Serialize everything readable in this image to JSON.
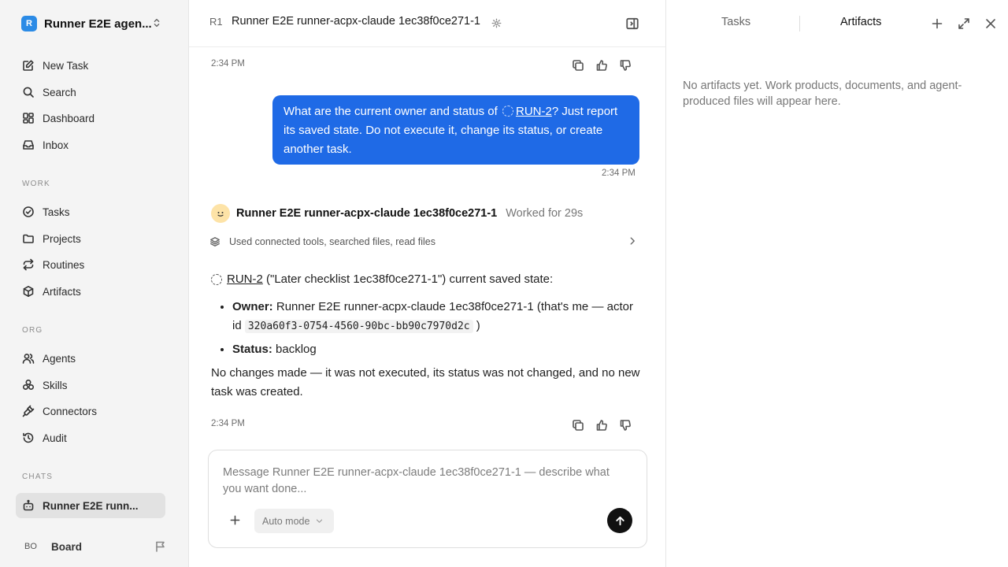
{
  "sidebar": {
    "workspace": {
      "logo": "R",
      "name": "Runner E2E agen..."
    },
    "primary": [
      {
        "label": "New Task",
        "icon": "edit-icon"
      },
      {
        "label": "Search",
        "icon": "search-icon"
      },
      {
        "label": "Dashboard",
        "icon": "dashboard-icon"
      },
      {
        "label": "Inbox",
        "icon": "inbox-icon"
      }
    ],
    "work_label": "WORK",
    "work": [
      {
        "label": "Tasks",
        "icon": "check-circle-icon"
      },
      {
        "label": "Projects",
        "icon": "folder-icon"
      },
      {
        "label": "Routines",
        "icon": "repeat-icon"
      },
      {
        "label": "Artifacts",
        "icon": "cube-icon"
      }
    ],
    "org_label": "ORG",
    "org": [
      {
        "label": "Agents",
        "icon": "users-icon"
      },
      {
        "label": "Skills",
        "icon": "skills-icon"
      },
      {
        "label": "Connectors",
        "icon": "plug-icon"
      },
      {
        "label": "Audit",
        "icon": "history-icon"
      }
    ],
    "chats_label": "CHATS",
    "chats": [
      {
        "label": "Runner E2E runn...",
        "icon": "bot-icon"
      }
    ],
    "board": {
      "badge": "BO",
      "name": "Board"
    }
  },
  "main": {
    "prefix": "R1",
    "title": "Runner E2E runner-acpx-claude 1ec38f0ce271-1",
    "time_top": "2:34 PM",
    "user_message": {
      "before": "What are the current owner and status of",
      "link": "RUN-2",
      "after": "? Just report its saved state. Do not execute it, change its status, or create another task.",
      "time": "2:34 PM"
    },
    "agent": {
      "name": "Runner E2E runner-acpx-claude 1ec38f0ce271-1",
      "worked": "Worked for 29s",
      "tools": "Used connected tools, searched files, read files",
      "answer": {
        "link": "RUN-2",
        "intro": " (\"Later checklist 1ec38f0ce271-1\") current saved state:",
        "owner_label": "Owner:",
        "owner_value": " Runner E2E runner-acpx-claude 1ec38f0ce271-1 (that's me — actor id ",
        "owner_code": "320a60f3-0754-4560-90bc-bb90c7970d2c",
        "owner_end": " )",
        "status_label": "Status:",
        "status_value": " backlog",
        "closing": "No changes made — it was not executed, its status was not changed, and no new task was created."
      },
      "time": "2:34 PM"
    },
    "composer": {
      "placeholder": "Message Runner E2E runner-acpx-claude 1ec38f0ce271-1 — describe what you want done...",
      "mode": "Auto mode"
    }
  },
  "panel": {
    "tabs": [
      "Tasks",
      "Artifacts"
    ],
    "active_tab": "Artifacts",
    "empty": "No artifacts yet. Work products, documents, and agent-produced files will appear here."
  },
  "colors": {
    "accent": "#1f6ae6",
    "sidebar_bg": "#f4f4f4",
    "send_button": "#111111",
    "avatar": "#fde3a7"
  }
}
